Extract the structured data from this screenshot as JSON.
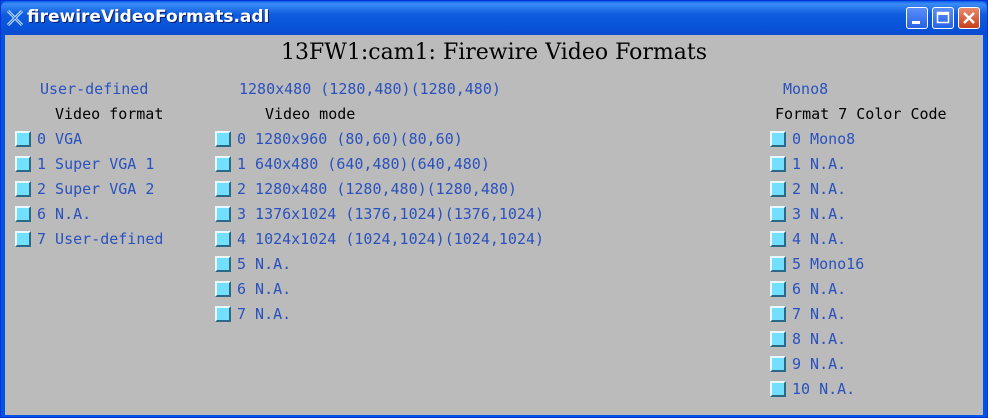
{
  "window": {
    "title": "firewireVideoFormats.adl"
  },
  "screen": {
    "heading": "13FW1:cam1: Firewire Video Formats",
    "video_format": {
      "readback": "User-defined",
      "label": "Video format",
      "options": [
        "0 VGA",
        "1 Super VGA 1",
        "2 Super VGA 2",
        "6 N.A.",
        "7 User-defined"
      ]
    },
    "video_mode": {
      "readback": "1280x480 (1280,480)(1280,480)",
      "label": "Video mode",
      "options": [
        "0 1280x960 (80,60)(80,60)",
        "1 640x480 (640,480)(640,480)",
        "2 1280x480 (1280,480)(1280,480)",
        "3 1376x1024 (1376,1024)(1376,1024)",
        "4 1024x1024 (1024,1024)(1024,1024)",
        "5 N.A.",
        "6 N.A.",
        "7 N.A."
      ]
    },
    "color_code": {
      "readback": "Mono8",
      "label": "Format 7 Color Code",
      "options": [
        "0 Mono8",
        "1 N.A.",
        "2 N.A.",
        "3 N.A.",
        "4 N.A.",
        "5 Mono16",
        "6 N.A.",
        "7 N.A.",
        "8 N.A.",
        "9 N.A.",
        "10 N.A."
      ]
    }
  }
}
